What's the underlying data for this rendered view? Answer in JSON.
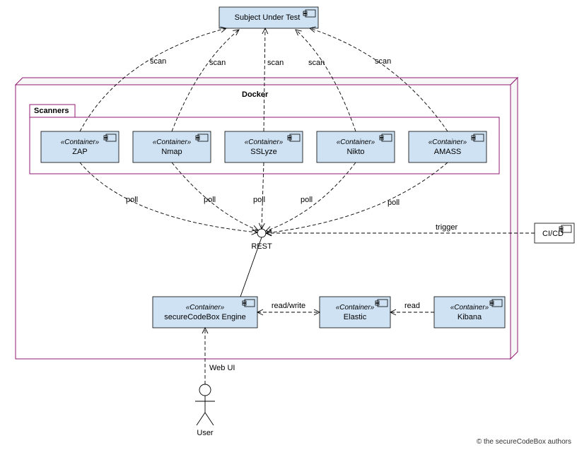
{
  "stereotypes": {
    "container": "«Container»"
  },
  "subject": "Subject Under Test",
  "dockerLabel": "Docker",
  "scannersLabel": "Scanners",
  "scanners": {
    "zap": "ZAP",
    "nmap": "Nmap",
    "sslyze": "SSLyze",
    "nikto": "Nikto",
    "amass": "AMASS"
  },
  "engine": "secureCodeBox Engine",
  "elastic": "Elastic",
  "kibana": "Kibana",
  "cicd": "CI/CD",
  "restLabel": "REST",
  "userLabel": "User",
  "relations": {
    "scan": "scan",
    "poll": "poll",
    "trigger": "trigger",
    "readwrite": "read/write",
    "read": "read",
    "webui": "Web UI"
  },
  "copyright": "© the secureCodeBox authors"
}
